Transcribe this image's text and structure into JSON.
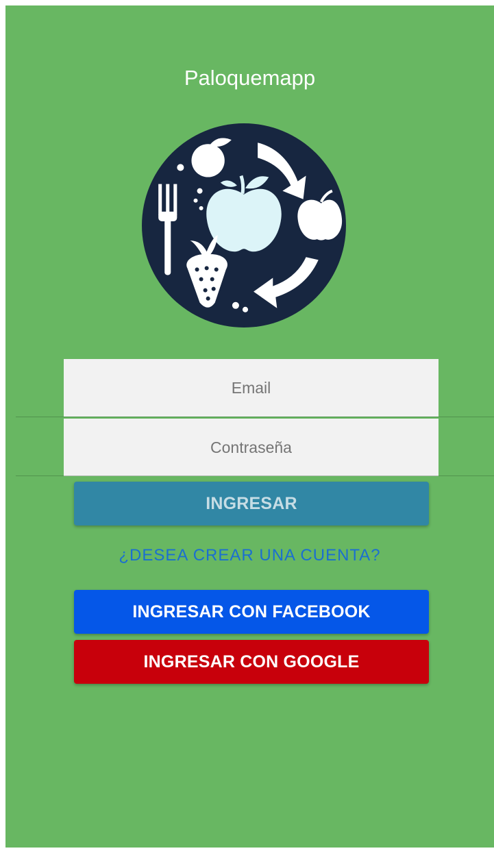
{
  "app": {
    "title": "Paloquemapp"
  },
  "logo": {
    "icon": "fruits-fork-cycle-logo",
    "background": "#172640",
    "accent": "#dcf4f8"
  },
  "form": {
    "email": {
      "placeholder": "Email",
      "value": ""
    },
    "password": {
      "placeholder": "Contraseña",
      "value": ""
    }
  },
  "buttons": {
    "login": "INGRESAR",
    "create_account": "¿DESEA CREAR UNA CUENTA?",
    "facebook": "INGRESAR CON FACEBOOK",
    "google": "INGRESAR CON GOOGLE"
  },
  "colors": {
    "background": "#68b762",
    "login": "#3187a5",
    "facebook": "#0557e8",
    "google": "#c8000b",
    "link": "#1b6fd0"
  }
}
